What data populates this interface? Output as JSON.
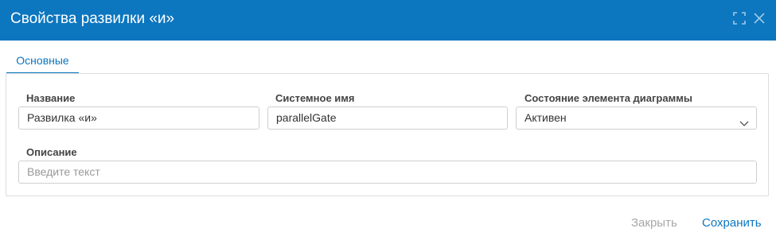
{
  "dialog": {
    "title": "Свойства развилки «и»",
    "icons": {
      "expand": "expand-icon",
      "close": "close-icon"
    }
  },
  "tabs": [
    {
      "label": "Основные",
      "active": true
    }
  ],
  "form": {
    "name_label": "Название",
    "name_value": "Развилка «и»",
    "system_name_label": "Системное имя",
    "system_name_value": "parallelGate",
    "state_label": "Состояние элемента диаграммы",
    "state_value": "Активен",
    "description_label": "Описание",
    "description_placeholder": "Введите текст"
  },
  "footer": {
    "close_label": "Закрыть",
    "save_label": "Сохранить"
  },
  "colors": {
    "accent": "#0c76bf",
    "disabled_text": "#a7a7a7",
    "border": "#cfcfcf"
  }
}
